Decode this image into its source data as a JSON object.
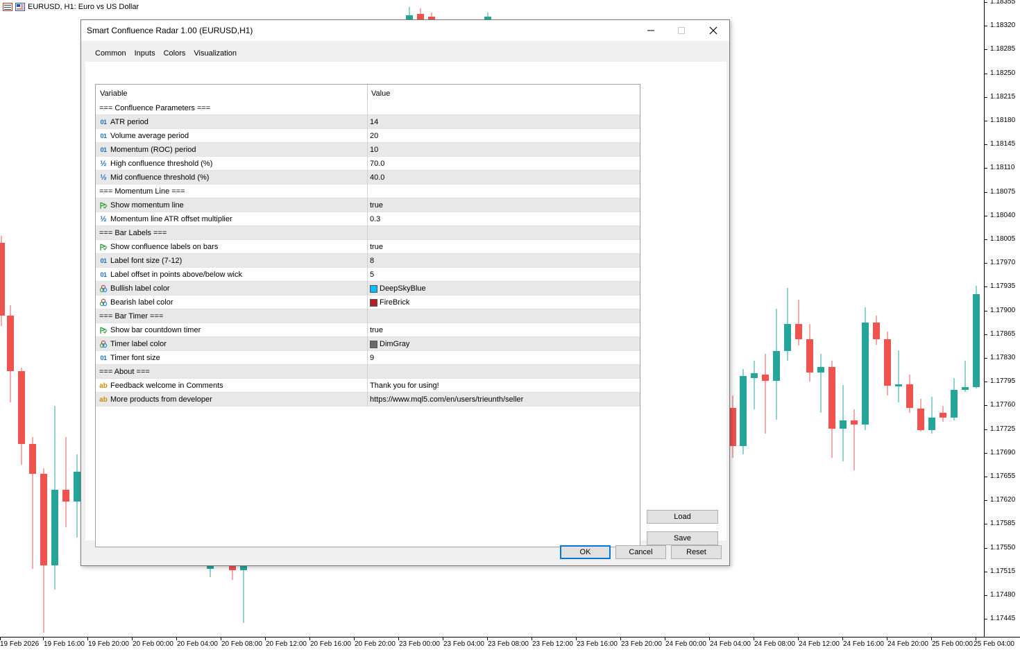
{
  "chart": {
    "symbol_title": "EURUSD, H1:  Euro vs US Dollar",
    "bull_color": "#26a69a",
    "bear_color": "#ef5350",
    "price_labels": [
      "1.18355",
      "1.18320",
      "1.18285",
      "1.18250",
      "1.18215",
      "1.18180",
      "1.18145",
      "1.18110",
      "1.18075",
      "1.18040",
      "1.18005",
      "1.17970",
      "1.17935",
      "1.17900",
      "1.17865",
      "1.17830",
      "1.17795",
      "1.17760",
      "1.17725",
      "1.17690",
      "1.17655",
      "1.17620",
      "1.17585",
      "1.17550",
      "1.17515",
      "1.17480",
      "1.17445"
    ],
    "time_labels": [
      "19 Feb 2026",
      "19 Feb 16:00",
      "19 Feb 20:00",
      "20 Feb 00:00",
      "20 Feb 04:00",
      "20 Feb 08:00",
      "20 Feb 12:00",
      "20 Feb 16:00",
      "20 Feb 20:00",
      "23 Feb 00:00",
      "23 Feb 04:00",
      "23 Feb 08:00",
      "23 Feb 12:00",
      "23 Feb 16:00",
      "23 Feb 20:00",
      "24 Feb 00:00",
      "24 Feb 04:00",
      "24 Feb 08:00",
      "24 Feb 12:00",
      "24 Feb 16:00",
      "24 Feb 20:00",
      "25 Feb 00:00",
      "25 Feb 04:00"
    ]
  },
  "dialog": {
    "title": "Smart Confluence Radar 1.00 (EURUSD,H1)",
    "tabs": [
      {
        "label": "Common",
        "active": false
      },
      {
        "label": "Inputs",
        "active": true
      },
      {
        "label": "Colors",
        "active": false
      },
      {
        "label": "Visualization",
        "active": false
      }
    ],
    "grid": {
      "col_variable": "Variable",
      "col_value": "Value",
      "rows": [
        {
          "type": "header",
          "name": "=== Confluence Parameters ===",
          "value": ""
        },
        {
          "type": "int",
          "name": "ATR period",
          "value": "14"
        },
        {
          "type": "int",
          "name": "Volume average period",
          "value": "20"
        },
        {
          "type": "int",
          "name": "Momentum (ROC) period",
          "value": "10"
        },
        {
          "type": "double",
          "name": "High confluence threshold (%)",
          "value": "70.0"
        },
        {
          "type": "double",
          "name": "Mid confluence threshold (%)",
          "value": "40.0"
        },
        {
          "type": "header",
          "name": "=== Momentum Line ===",
          "value": ""
        },
        {
          "type": "bool",
          "name": "Show momentum line",
          "value": "true"
        },
        {
          "type": "double",
          "name": "Momentum line ATR offset multiplier",
          "value": "0.3"
        },
        {
          "type": "header",
          "name": "=== Bar Labels ===",
          "value": ""
        },
        {
          "type": "bool",
          "name": "Show confluence labels on bars",
          "value": "true"
        },
        {
          "type": "int",
          "name": "Label font size (7-12)",
          "value": "8"
        },
        {
          "type": "int",
          "name": "Label offset in points above/below wick",
          "value": "5"
        },
        {
          "type": "color",
          "name": "Bullish label color",
          "value": "DeepSkyBlue",
          "swatch": "#00bfff"
        },
        {
          "type": "color",
          "name": "Bearish label color",
          "value": "FireBrick",
          "swatch": "#b22222"
        },
        {
          "type": "header",
          "name": "=== Bar Timer ===",
          "value": ""
        },
        {
          "type": "bool",
          "name": "Show bar countdown timer",
          "value": "true"
        },
        {
          "type": "color",
          "name": "Timer label color",
          "value": "DimGray",
          "swatch": "#696969"
        },
        {
          "type": "int",
          "name": "Timer font size",
          "value": "9"
        },
        {
          "type": "header",
          "name": "=== About ===",
          "value": ""
        },
        {
          "type": "string",
          "name": "Feedback welcome in Comments",
          "value": "Thank you for using!"
        },
        {
          "type": "string",
          "name": "More products from developer",
          "value": "https://www.mql5.com/en/users/trieunth/seller"
        }
      ]
    },
    "buttons": {
      "load": "Load",
      "save": "Save",
      "ok": "OK",
      "cancel": "Cancel",
      "reset": "Reset"
    },
    "icons": {
      "int": "01",
      "double": "½",
      "string": "ab"
    }
  }
}
